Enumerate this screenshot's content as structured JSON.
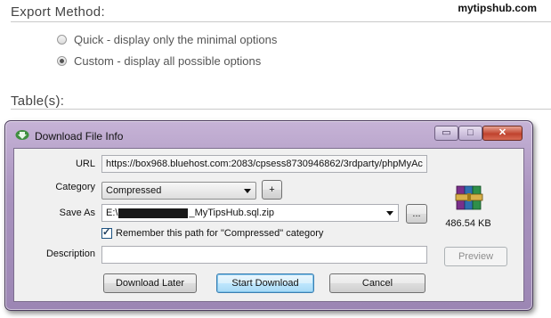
{
  "page": {
    "export_method_heading": "Export Method:",
    "watermark": "mytipshub.com",
    "options": [
      {
        "label": "Quick - display only the minimal options",
        "selected": false
      },
      {
        "label": "Custom - display all possible options",
        "selected": true
      }
    ],
    "tables_heading": "Table(s):"
  },
  "dialog": {
    "title": "Download File Info",
    "window_controls": {
      "minimize": "▭",
      "maximize": "□",
      "close": "✕"
    },
    "url": {
      "label": "URL",
      "value": "https://box968.bluehost.com:2083/cpsess8730946862/3rdparty/phpMyAc"
    },
    "category": {
      "label": "Category",
      "value": "Compressed",
      "add_label": "+"
    },
    "save_as": {
      "label": "Save As",
      "prefix": "E:\\",
      "suffix": "_MyTipsHub.sql.zip",
      "browse_label": "..."
    },
    "remember": {
      "label": "Remember this path for \"Compressed\" category",
      "checked": true
    },
    "description": {
      "label": "Description",
      "value": ""
    },
    "file_size": "486.54  KB",
    "buttons": {
      "preview": "Preview",
      "download_later": "Download Later",
      "start_download": "Start Download",
      "cancel": "Cancel"
    },
    "icons": {
      "title": "download-manager-icon",
      "file": "winrar-archive-icon"
    }
  }
}
